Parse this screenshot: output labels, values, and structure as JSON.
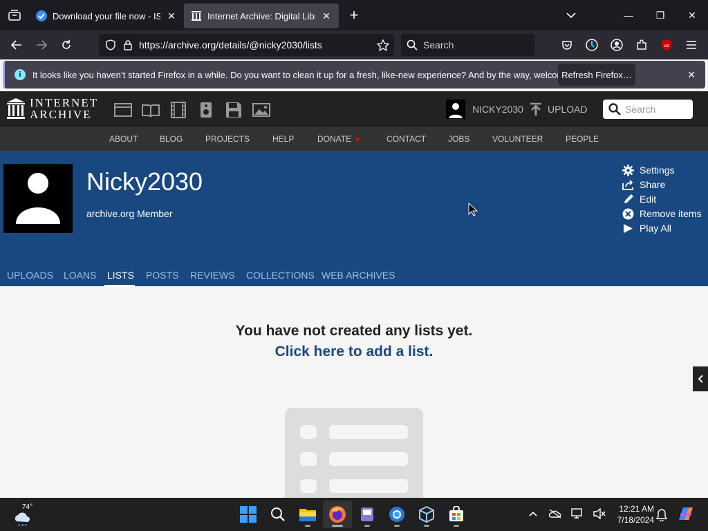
{
  "browser": {
    "tabs": [
      {
        "title": "Download your file now - ISORi",
        "active": false,
        "icon": "checkmark-favicon"
      },
      {
        "title": "Internet Archive: Digital Library",
        "active": true,
        "icon": "archive-favicon"
      }
    ],
    "url": "https://archive.org/details/@nicky2030/lists",
    "search_placeholder": "Search",
    "notification": {
      "message": "It looks like you haven’t started Firefox in a while. Do you want to clean it up for a fresh, like-new experience? And by the way, welcome back!",
      "button": "Refresh Firefox…"
    }
  },
  "ia": {
    "logo_line1": "INTERNET",
    "logo_line2": "ARCHIVE",
    "username": "NICKY2030",
    "upload_label": "UPLOAD",
    "search_placeholder": "Search",
    "nav": [
      "ABOUT",
      "BLOG",
      "PROJECTS",
      "HELP",
      "DONATE",
      "CONTACT",
      "JOBS",
      "VOLUNTEER",
      "PEOPLE"
    ]
  },
  "profile": {
    "name": "Nicky2030",
    "member": "archive.org Member",
    "actions": [
      "Settings",
      "Share",
      "Edit",
      "Remove items",
      "Play All"
    ],
    "tabs": [
      "UPLOADS",
      "LOANS",
      "LISTS",
      "POSTS",
      "REVIEWS",
      "COLLECTIONS",
      "WEB ARCHIVES"
    ],
    "active_tab": "LISTS"
  },
  "content": {
    "empty_title": "You have not created any lists yet.",
    "empty_link": "Click here to add a list."
  },
  "taskbar": {
    "temperature": "74°",
    "time": "12:21 AM",
    "date": "7/18/2024"
  },
  "colors": {
    "ia_blue": "#194880",
    "ia_dark": "#222222",
    "browser_dark": "#1c1b22"
  }
}
